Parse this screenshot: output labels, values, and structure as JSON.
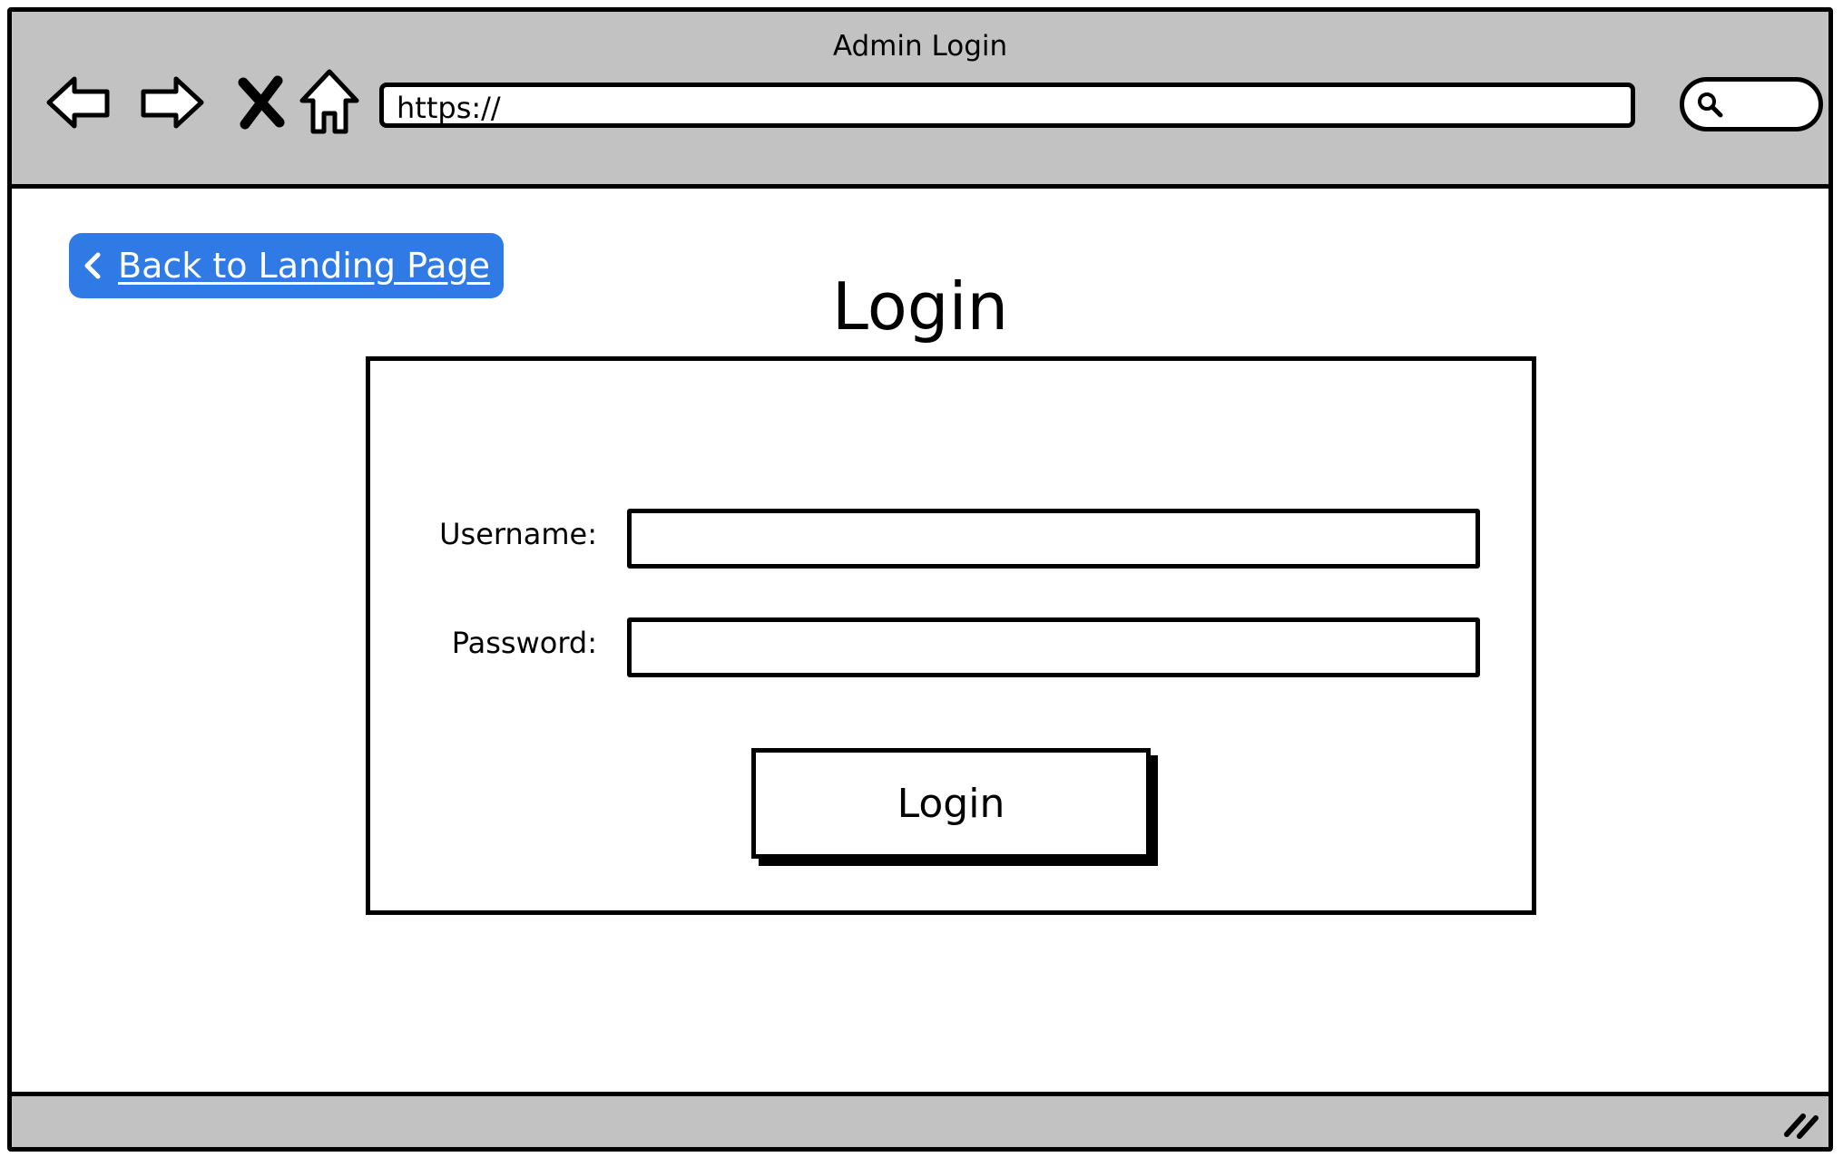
{
  "window": {
    "title": "Admin Login"
  },
  "toolbar": {
    "icons": [
      "back-arrow-icon",
      "forward-arrow-icon",
      "close-x-icon",
      "home-icon",
      "search-icon",
      "resize-grip-icon"
    ],
    "address": "https://"
  },
  "page": {
    "back_link": "Back to Landing Page",
    "title": "Login"
  },
  "form": {
    "username_label": "Username:",
    "username_value": "",
    "password_label": "Password:",
    "password_value": "",
    "submit_label": "Login"
  },
  "colors": {
    "chrome": "#c2c2c2",
    "accent": "#2f7ae5",
    "border": "#000000",
    "background": "#ffffff"
  }
}
